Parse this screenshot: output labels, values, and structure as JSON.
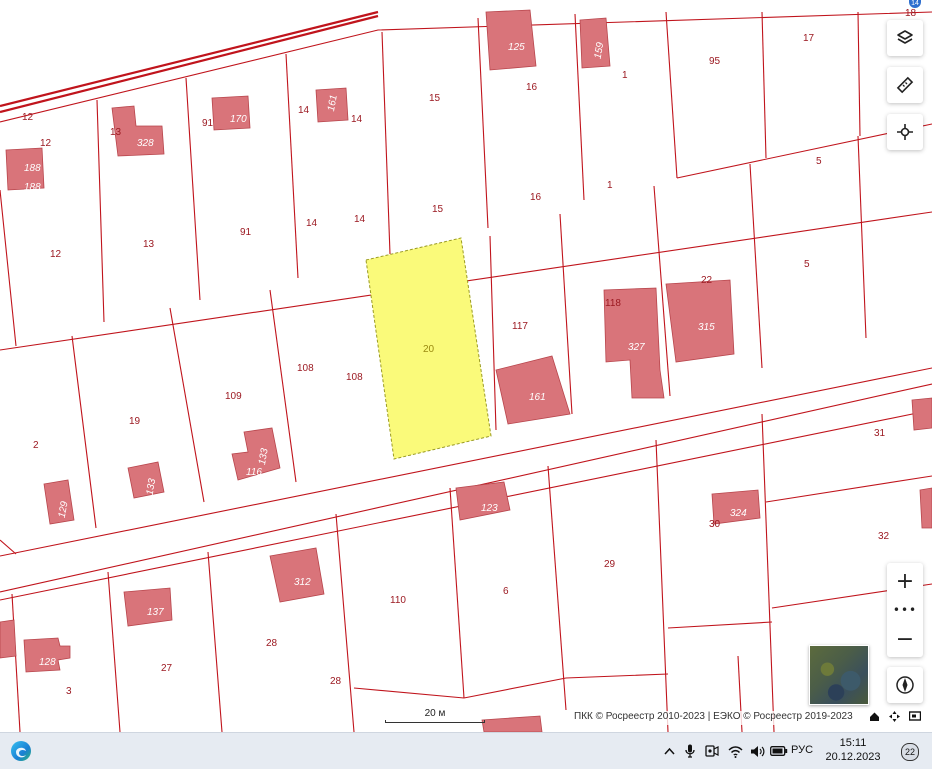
{
  "map": {
    "selected_parcel_label": "20",
    "parcel_labels": [
      "12",
      "12",
      "12",
      "13",
      "13",
      "91",
      "91",
      "14",
      "14",
      "14",
      "14",
      "15",
      "15",
      "16",
      "16",
      "1",
      "1",
      "95",
      "17",
      "18",
      "5",
      "5",
      "22",
      "117",
      "118",
      "108",
      "108",
      "109",
      "19",
      "2",
      "31",
      "32",
      "30",
      "29",
      "6",
      "110",
      "28",
      "28",
      "27",
      "3"
    ],
    "building_labels": [
      "188",
      "188",
      "328",
      "170",
      "161",
      "125",
      "159",
      "315",
      "327",
      "161",
      "133",
      "116",
      "133",
      "129",
      "123",
      "324",
      "312",
      "137",
      "128"
    ],
    "scale": {
      "label": "20 м"
    },
    "attribution": "ПКК © Росреестр 2010-2023 | ЕЭКО © Росреестр 2019-2023"
  },
  "controls": {
    "layers_icon": "layers-icon",
    "ruler_icon": "ruler-icon",
    "location_icon": "crosshair-icon",
    "zoom_in_label": "+",
    "zoom_more_label": "•••",
    "zoom_out_label": "−",
    "compass_icon": "compass-icon",
    "top_badge": "14"
  },
  "taskbar": {
    "language": "РУС",
    "time": "15:11",
    "date": "20.12.2023",
    "notifications_count": "22"
  }
}
